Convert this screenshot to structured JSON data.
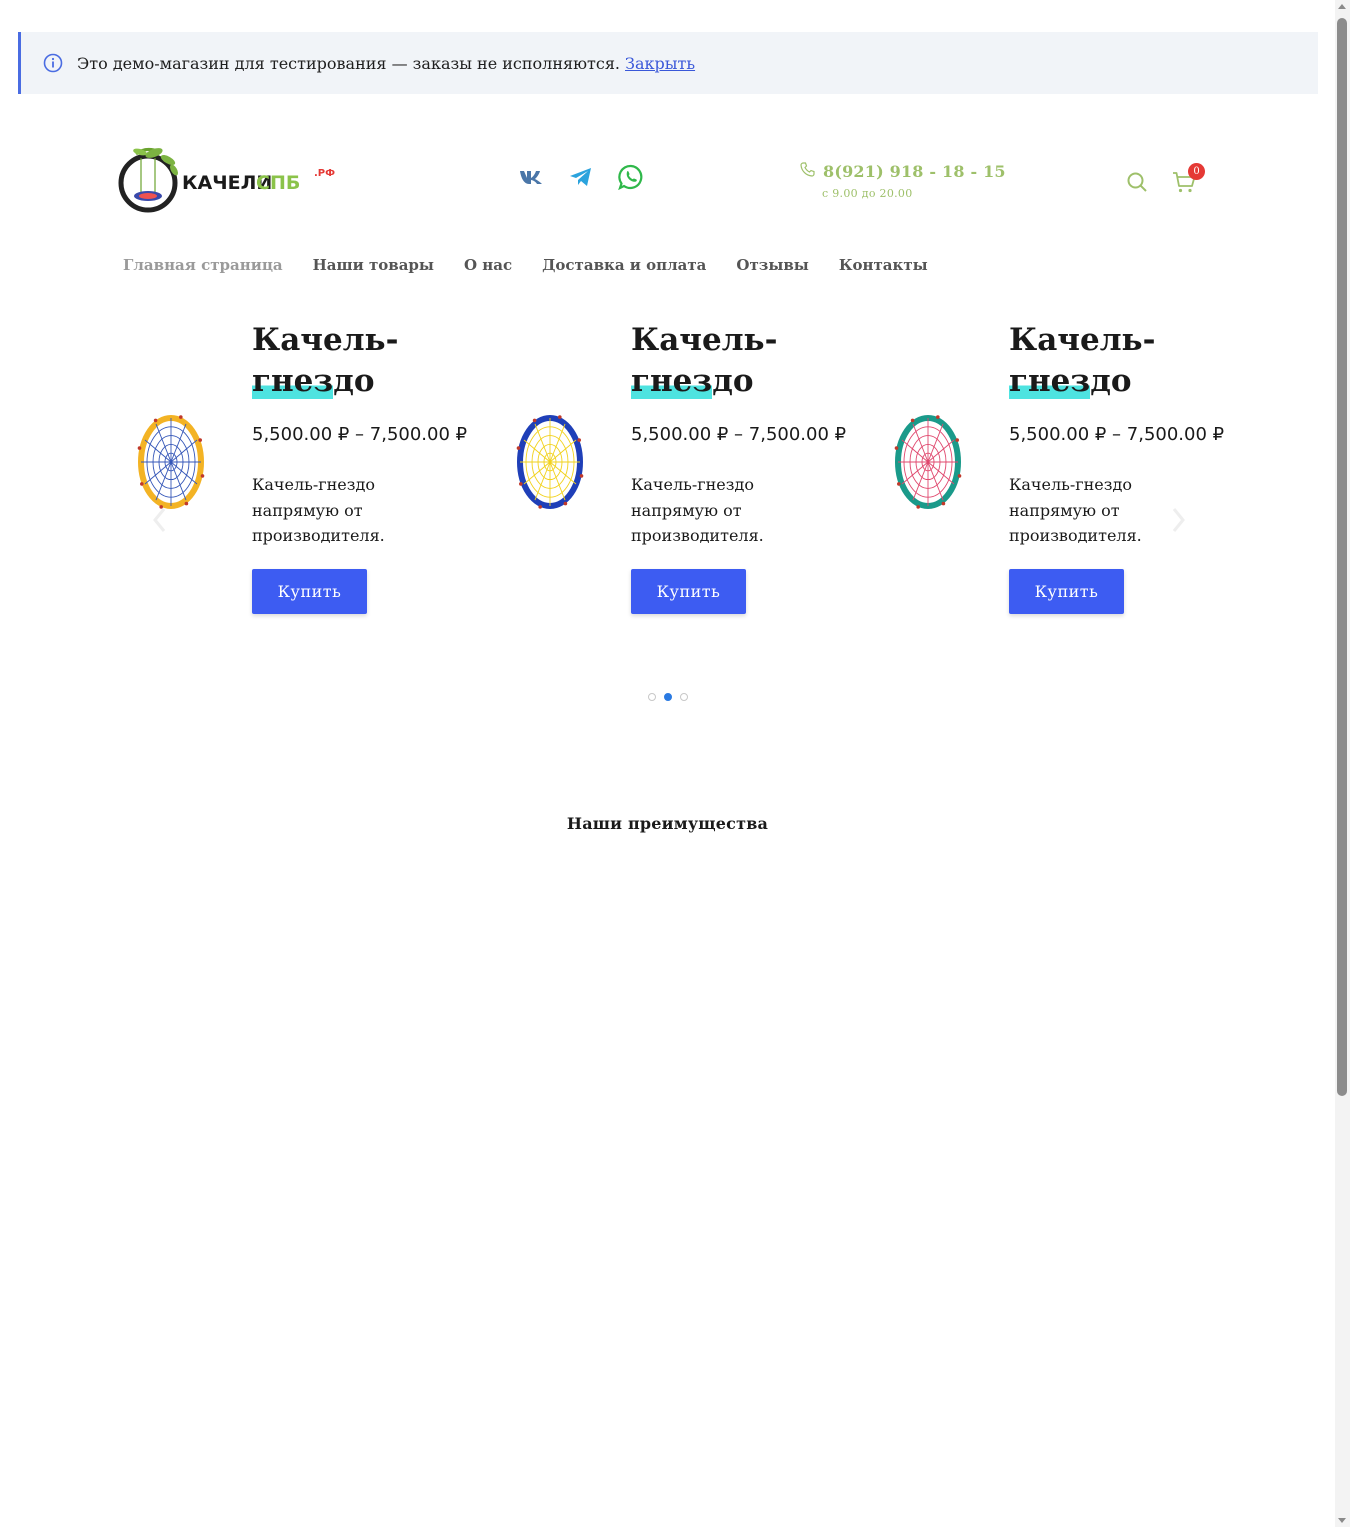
{
  "notice": {
    "text": "Это демо-магазин для тестирования — заказы не исполняются.",
    "link": "Закрыть"
  },
  "logo": {
    "main": "КАЧЕЛИ",
    "accent": "СПБ",
    "suffix": ".РФ"
  },
  "social": [
    "vk-icon",
    "telegram-icon",
    "whatsapp-icon"
  ],
  "contact": {
    "phone": "8(921) 918 - 18 - 15",
    "hours": "с 9.00 до 20.00"
  },
  "cart": {
    "count": "0"
  },
  "nav": {
    "items": [
      {
        "label": "Главная страница"
      },
      {
        "label": "Наши товары"
      },
      {
        "label": "О нас"
      },
      {
        "label": "Доставка и оплата"
      },
      {
        "label": "Отзывы"
      },
      {
        "label": "Контакты"
      }
    ]
  },
  "slides": [
    {
      "title_a": "Качель-",
      "title_hl": "гнез",
      "title_b": "до",
      "price": "5,500.00 ₽ – 7,500.00 ₽",
      "desc": "Качель-гнездо напрямую от производителя.",
      "button": "Купить",
      "colors": {
        "frame": "#f3b324",
        "net": "#3557b8"
      }
    },
    {
      "title_a": "Качель-",
      "title_hl": "гнез",
      "title_b": "до",
      "price": "5,500.00 ₽ – 7,500.00 ₽",
      "desc": "Качель-гнездо напрямую от производителя.",
      "button": "Купить",
      "colors": {
        "frame": "#1f3fb8",
        "net": "#f2d21c"
      }
    },
    {
      "title_a": "Качель-",
      "title_hl": "гнез",
      "title_b": "до",
      "price": "5,500.00 ₽ – 7,500.00 ₽",
      "desc": "Качель-гнездо напрямую от производителя.",
      "button": "Купить",
      "colors": {
        "frame": "#1a9a8a",
        "net": "#e0486e"
      }
    }
  ],
  "carousel": {
    "pages": 3,
    "active_page": 2
  },
  "sections": {
    "advantages_title": "Наши преимущества"
  },
  "colors": {
    "accent_green": "#9ec06a",
    "button_blue": "#3d5cf2",
    "highlight_cyan": "#4ee3e0",
    "badge_red": "#e53935"
  }
}
